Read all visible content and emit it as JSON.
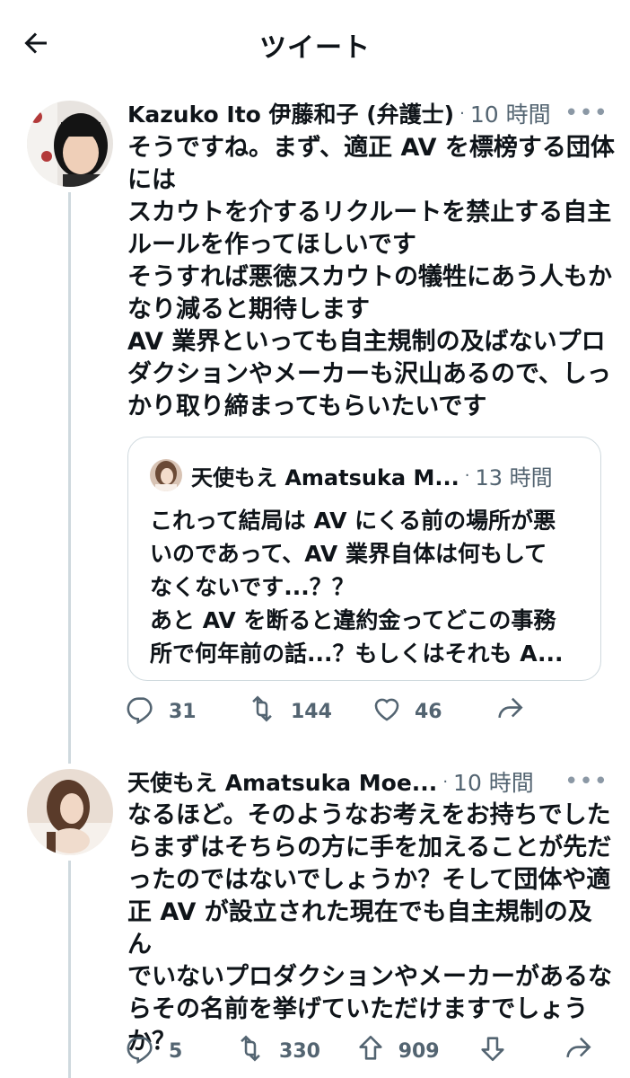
{
  "header": {
    "title": "ツイート",
    "back_icon": "arrow-left-icon"
  },
  "tweets": [
    {
      "author": "Kazuko Ito 伊藤和子 (弁護士)",
      "separator": "·",
      "time": "10 時間",
      "more": "•••",
      "text": "そうですね。まず、適正 AV を標榜する団体\nには\nスカウトを介するリクルートを禁止する自主\nルールを作ってほしいです\nそうすれば悪徳スカウトの犠牲にあう人もか\nなり減ると期待します\nAV 業界といっても自主規制の及ばないプロ\nダクションやメーカーも沢山あるので、しっ\nかり取り締まってもらいたいです",
      "quote": {
        "author": "天使もえ Amatsuka M...",
        "separator": "·",
        "time": "13 時間",
        "text": "これって結局は AV にくる前の場所が悪\nいのであって、AV 業界自体は何もして\nなくないです...？？\nあと AV を断ると違約金ってどこの事務\n所で何年前の話...？もしくはそれも A..."
      },
      "actions": {
        "reply_count": "31",
        "retweet_count": "144",
        "like_count": "46"
      }
    },
    {
      "author": "天使もえ Amatsuka Moe...",
      "separator": "·",
      "time": "10 時間",
      "more": "•••",
      "text": "なるほど。そのようなお考えをお持ちでした\nらまずはそちらの方に手を加えることが先だ\nったのではないでしょうか？そして団体や適\n正 AV が設立された現在でも自主規制の及ん\nでいないプロダクションやメーカーがあるな\nらその名前を挙げていただけますでしょう\nか？",
      "actions": {
        "reply_count": "5",
        "retweet_count": "330",
        "upvote_count": "909"
      }
    }
  ],
  "colors": {
    "text": "#0f1419",
    "secondary": "#536471",
    "border": "#cfd9de",
    "background": "#ffffff"
  }
}
